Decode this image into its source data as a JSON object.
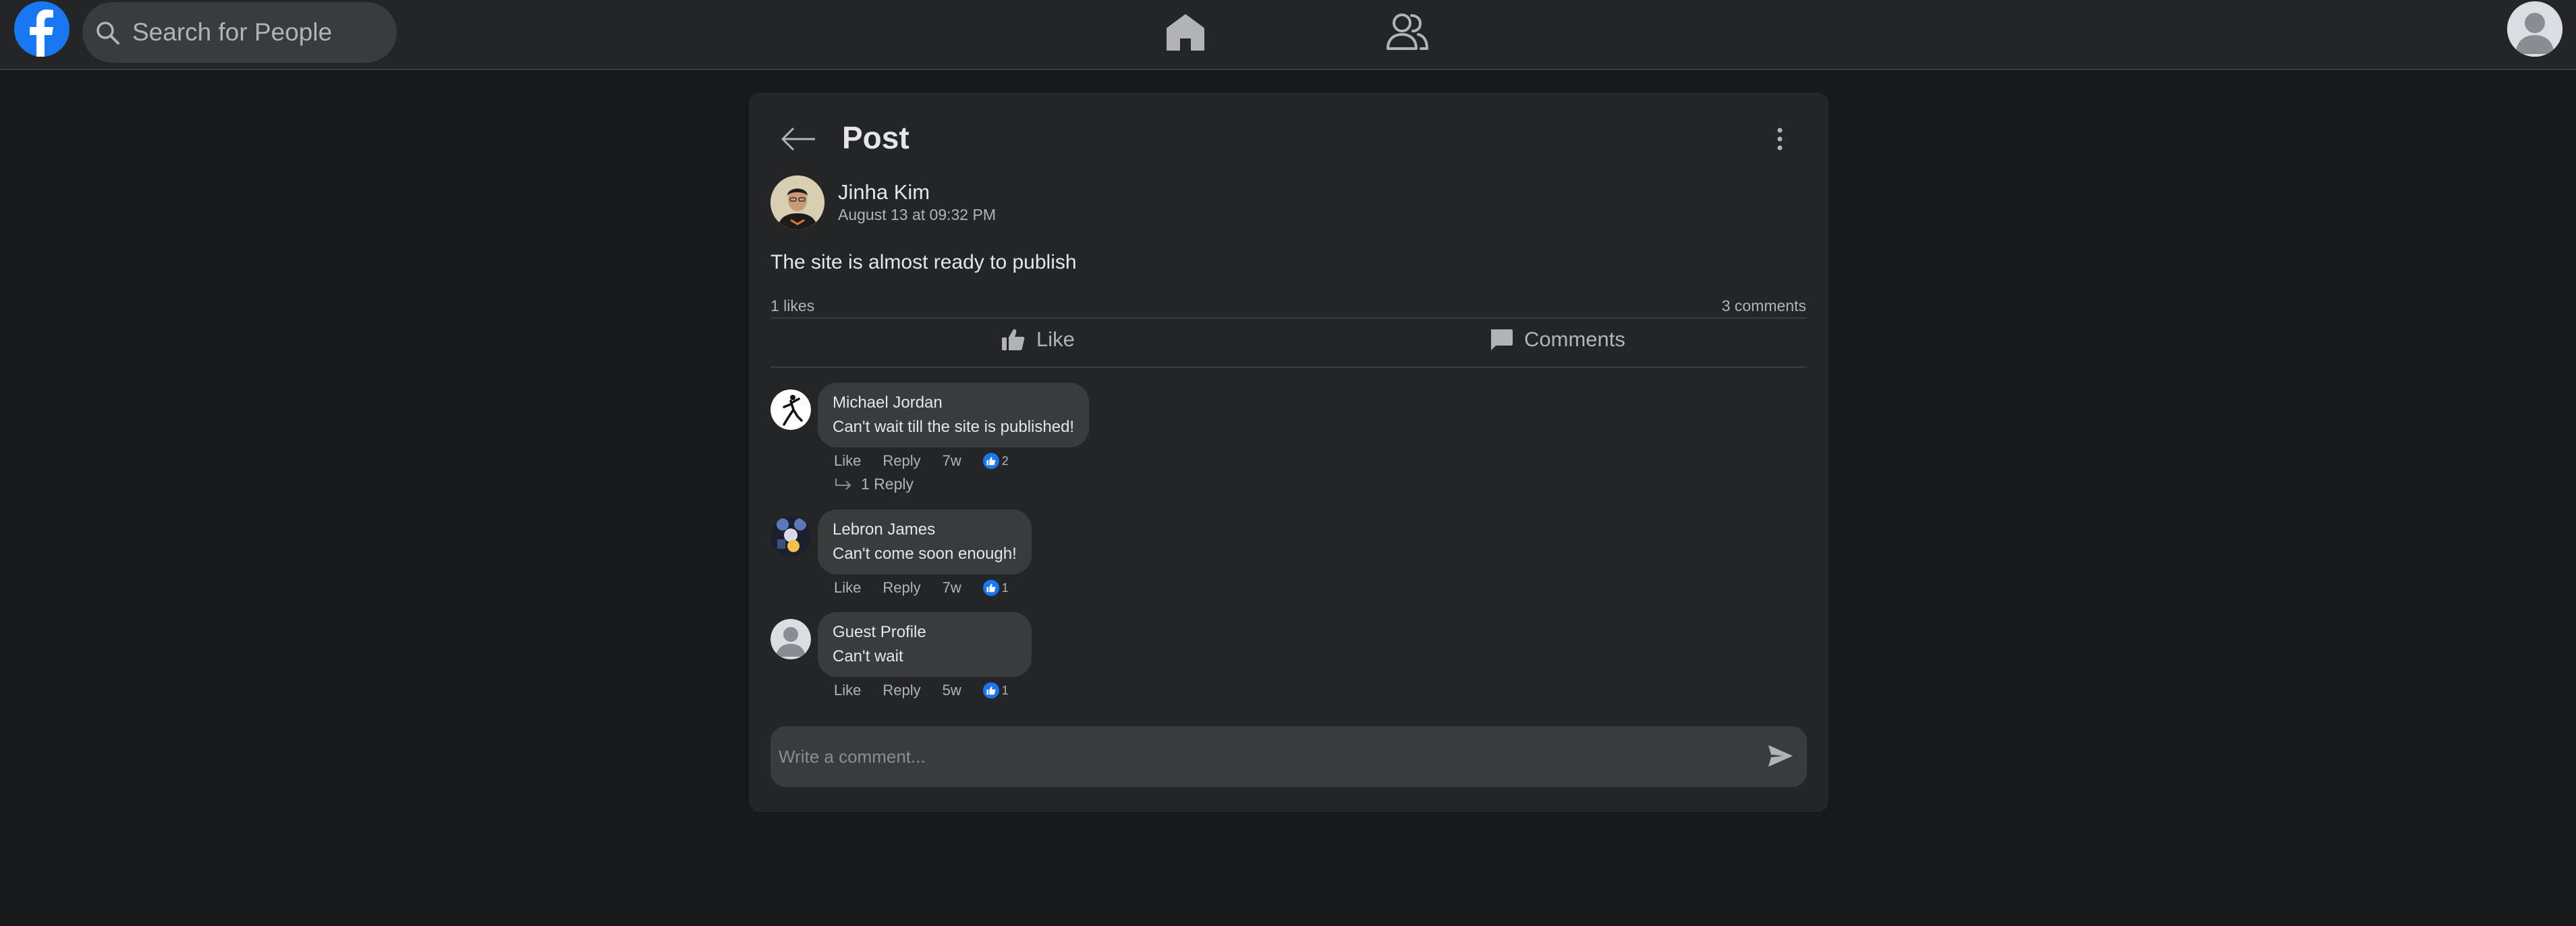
{
  "nav": {
    "search_placeholder": "Search for People",
    "brand_color": "#1877f2"
  },
  "post": {
    "title": "Post",
    "author": "Jinha Kim",
    "date": "August 13 at 09:32 PM",
    "text": "The site is almost ready to publish",
    "likes_label": "1 likes",
    "comments_label": "3 comments",
    "like_action": "Like",
    "comments_action": "Comments"
  },
  "comments": [
    {
      "name": "Michael Jordan",
      "text": "Can't wait till the site is published!",
      "like": "Like",
      "reply": "Reply",
      "time": "7w",
      "likes": "2",
      "replies_label": "1 Reply"
    },
    {
      "name": "Lebron James",
      "text": "Can't come soon enough!",
      "like": "Like",
      "reply": "Reply",
      "time": "7w",
      "likes": "1"
    },
    {
      "name": "Guest Profile",
      "text": "Can't wait",
      "like": "Like",
      "reply": "Reply",
      "time": "5w",
      "likes": "1"
    }
  ],
  "composer": {
    "placeholder": "Write a comment..."
  }
}
